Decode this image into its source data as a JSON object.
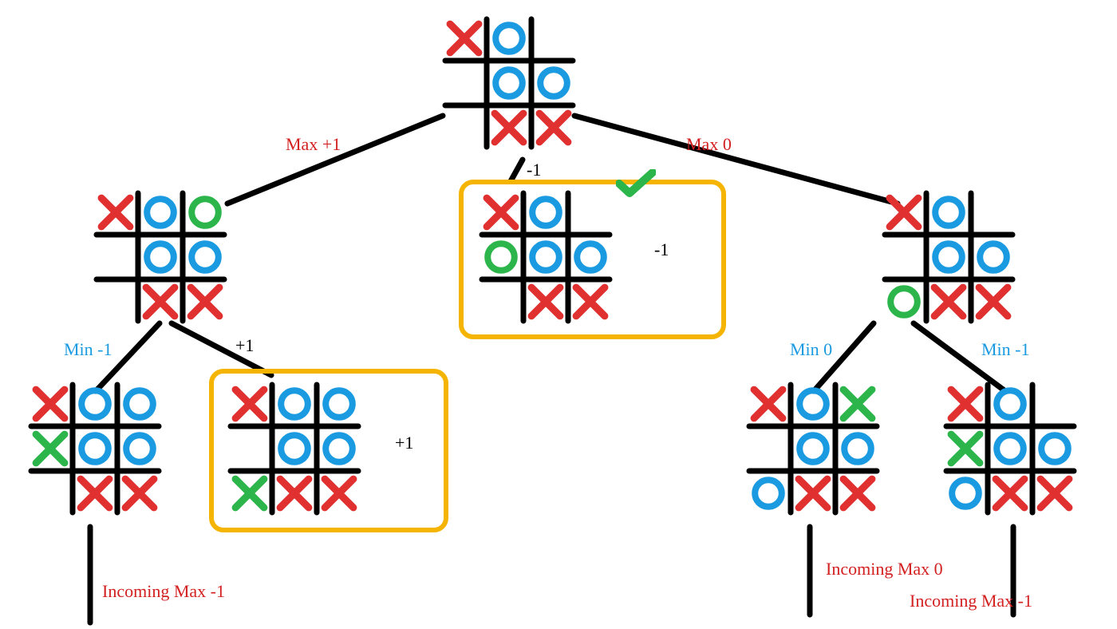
{
  "diagram": {
    "description": "Minimax game tree for tic-tac-toe",
    "marks": {
      "X": "X",
      "O": "O",
      "E": ""
    },
    "colors": {
      "x_red": "#e03030",
      "o_blue": "#1a9ae0",
      "new_green": "#2bb54a",
      "grid": "#000000",
      "highlight": "#f5b400"
    },
    "boards": {
      "root": {
        "cells": [
          "X",
          "O",
          "",
          "",
          "O",
          "O",
          "",
          "X",
          "X"
        ],
        "new_index": null
      },
      "L1_left": {
        "cells": [
          "X",
          "O",
          "O",
          "",
          "O",
          "O",
          "",
          "X",
          "X"
        ],
        "new_index": 2
      },
      "L1_mid": {
        "cells": [
          "X",
          "O",
          "",
          "O",
          "O",
          "O",
          "",
          "X",
          "X"
        ],
        "new_index": 3,
        "highlighted": true,
        "checkmark": true
      },
      "L1_right": {
        "cells": [
          "X",
          "O",
          "",
          "",
          "O",
          "O",
          "O",
          "X",
          "X"
        ],
        "new_index": 6
      },
      "L2_a": {
        "cells": [
          "X",
          "O",
          "O",
          "X",
          "O",
          "O",
          "",
          "X",
          "X"
        ],
        "new_index": 3
      },
      "L2_b": {
        "cells": [
          "X",
          "O",
          "O",
          "",
          "O",
          "O",
          "X",
          "X",
          "X"
        ],
        "new_index": 6,
        "highlighted": true
      },
      "L2_c": {
        "cells": [
          "X",
          "O",
          "X",
          "",
          "O",
          "O",
          "O",
          "X",
          "X"
        ],
        "new_index": 2
      },
      "L2_d": {
        "cells": [
          "X",
          "O",
          "",
          "X",
          "O",
          "O",
          "O",
          "X",
          "X"
        ],
        "new_index": 3
      }
    },
    "labels": {
      "max_left": "Max +1",
      "max_right": "Max 0",
      "mid_top": "-1",
      "mid_side": "-1",
      "plus1_edge": "+1",
      "plus1_side": "+1",
      "min_left": "Min -1",
      "min_r1": "Min 0",
      "min_r2": "Min -1",
      "inc_left": "Incoming Max -1",
      "inc_mid": "Incoming Max 0",
      "inc_right": "Incoming Max -1"
    }
  }
}
